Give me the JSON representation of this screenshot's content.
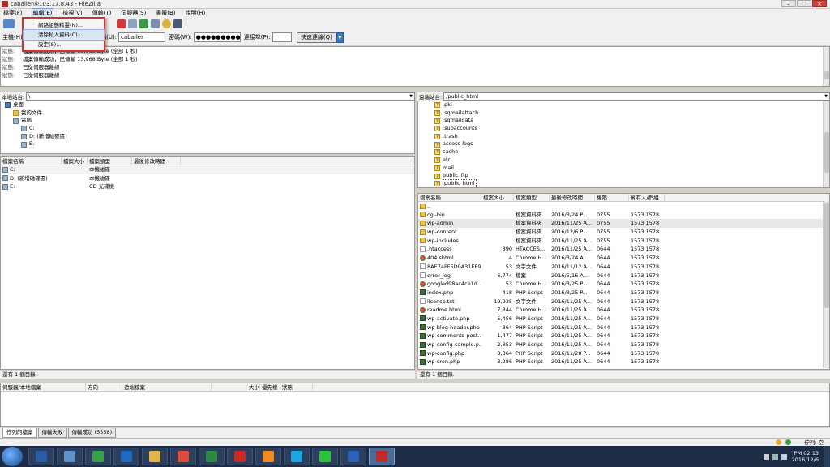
{
  "window": {
    "title": "caballer@103.17.8.43 - FileZilla"
  },
  "menubar": [
    "檔案(F)",
    "編輯(E)",
    "檢視(V)",
    "傳輸(T)",
    "伺服器(S)",
    "書籤(B)",
    "說明(H)"
  ],
  "edit_menu": {
    "items": [
      "網路組態精靈(N)...",
      "清除私人資料(C)...",
      "設定(S)..."
    ],
    "highlighted": 1
  },
  "quickconnect": {
    "host_label": "主機(H):",
    "user_label": "使用者名稱(U):",
    "user_value": "caballer",
    "pass_label": "密碼(W):",
    "pass_value": "●●●●●●●●●",
    "port_label": "連接埠(P):",
    "port_value": "",
    "button": "快速連線(Q)"
  },
  "log": [
    {
      "k": "狀態:",
      "v": "檔案傳輸成功，已傳輸 13,968 Byte (全部 1 秒)"
    },
    {
      "k": "狀態:",
      "v": "檔案傳輸成功，已傳輸 13,968 Byte (全部 1 秒)"
    },
    {
      "k": "狀態:",
      "v": "已從伺服器離線"
    },
    {
      "k": "狀態:",
      "v": "已從伺服器離線"
    }
  ],
  "local": {
    "path_label": "本地站台:",
    "path": "\\",
    "tree": [
      {
        "label": "桌面",
        "icon": "desk",
        "indent": 0
      },
      {
        "label": "我的文件",
        "icon": "folder",
        "indent": 1
      },
      {
        "label": "電腦",
        "icon": "drive",
        "indent": 1
      },
      {
        "label": "C:",
        "icon": "drive",
        "indent": 2
      },
      {
        "label": "D: (新增磁碟區)",
        "icon": "drive",
        "indent": 2
      },
      {
        "label": "E:",
        "icon": "drive",
        "indent": 2
      }
    ],
    "headers": [
      "檔案名稱",
      "檔案大小",
      "檔案類型",
      "最後修改時間"
    ],
    "files": [
      [
        "C:",
        "",
        "本機磁碟",
        ""
      ],
      [
        "D: (新增磁碟區)",
        "",
        "本機磁碟",
        ""
      ],
      [
        "E:",
        "",
        "CD 光碟機",
        ""
      ]
    ],
    "status": "還有 1 個目錄."
  },
  "remote": {
    "path_label": "遠端站台:",
    "path": "/public_html",
    "tree": [
      ".pki",
      ".sqmailattach",
      ".sqmaildata",
      ".subaccounts",
      ".trash",
      "access-logs",
      "cache",
      "etc",
      "mail",
      "public_ftp",
      "public_html"
    ],
    "headers": [
      "檔案名稱",
      "檔案大小",
      "檔案類型",
      "最後修改時間",
      "權限",
      "擁有人/群組"
    ],
    "files": [
      {
        "icon": "up",
        "c": [
          "..",
          "",
          "",
          "",
          "",
          ""
        ]
      },
      {
        "icon": "folder",
        "c": [
          "cgi-bin",
          "",
          "檔案資料夾",
          "2016/3/24 P...",
          "0755",
          "1573 1578"
        ]
      },
      {
        "icon": "folder",
        "c": [
          "wp-admin",
          "",
          "檔案資料夾",
          "2016/11/25 A...",
          "0755",
          "1573 1578"
        ]
      },
      {
        "icon": "folder",
        "c": [
          "wp-content",
          "",
          "檔案資料夾",
          "2016/12/6 P...",
          "0755",
          "1573 1578"
        ]
      },
      {
        "icon": "folder",
        "c": [
          "wp-includes",
          "",
          "檔案資料夾",
          "2016/11/25 A...",
          "0755",
          "1573 1578"
        ]
      },
      {
        "icon": "file",
        "c": [
          ".htaccess",
          "890",
          "HTACCES...",
          "2016/11/25 A...",
          "0644",
          "1573 1578"
        ]
      },
      {
        "icon": "chrome",
        "c": [
          "404.shtml",
          "4",
          "Chrome H...",
          "2016/3/24 A...",
          "0644",
          "1573 1578"
        ]
      },
      {
        "icon": "file",
        "c": [
          "8AE74FF5D0A31EE9...",
          "53",
          "文字文件",
          "2016/11/12 A...",
          "0644",
          "1573 1578"
        ]
      },
      {
        "icon": "file",
        "c": [
          "error_log",
          "6,774",
          "檔案",
          "2016/5/16 A...",
          "0644",
          "1573 1578"
        ]
      },
      {
        "icon": "chrome",
        "c": [
          "googled98ac4ce1d...",
          "53",
          "Chrome H...",
          "2016/3/25 P...",
          "0644",
          "1573 1578"
        ]
      },
      {
        "icon": "php",
        "c": [
          "index.php",
          "418",
          "PHP Script",
          "2016/3/25 P...",
          "0644",
          "1573 1578"
        ]
      },
      {
        "icon": "file",
        "c": [
          "license.txt",
          "19,935",
          "文字文件",
          "2016/11/25 A...",
          "0644",
          "1573 1578"
        ]
      },
      {
        "icon": "chrome",
        "c": [
          "readme.html",
          "7,344",
          "Chrome H...",
          "2016/11/25 A...",
          "0644",
          "1573 1578"
        ]
      },
      {
        "icon": "php",
        "c": [
          "wp-activate.php",
          "5,456",
          "PHP Script",
          "2016/11/25 A...",
          "0644",
          "1573 1578"
        ]
      },
      {
        "icon": "php",
        "c": [
          "wp-blog-header.php",
          "364",
          "PHP Script",
          "2016/11/25 A...",
          "0644",
          "1573 1578"
        ]
      },
      {
        "icon": "php",
        "c": [
          "wp-comments-post....",
          "1,477",
          "PHP Script",
          "2016/11/25 A...",
          "0644",
          "1573 1578"
        ]
      },
      {
        "icon": "php",
        "c": [
          "wp-config-sample.p...",
          "2,853",
          "PHP Script",
          "2016/11/25 A...",
          "0644",
          "1573 1578"
        ]
      },
      {
        "icon": "php",
        "c": [
          "wp-config.php",
          "3,364",
          "PHP Script",
          "2016/11/28 P...",
          "0644",
          "1573 1578"
        ]
      },
      {
        "icon": "php",
        "c": [
          "wp-cron.php",
          "3,286",
          "PHP Script",
          "2016/11/25 A...",
          "0644",
          "1573 1578"
        ]
      }
    ],
    "status": "還有 1 個目錄."
  },
  "queue": {
    "headers": [
      "伺服器/本地檔案",
      "方向",
      "遠端檔案",
      "大小",
      "優先權",
      "狀態"
    ],
    "tabs": [
      "佇列的檔案",
      "傳輸失敗",
      "傳輸成功 (5558)"
    ]
  },
  "statusbar": {
    "queue": "佇列: 空"
  },
  "taskbar": {
    "apps": [
      {
        "name": "ps",
        "color": "#2b5ca8"
      },
      {
        "name": "explorer",
        "color": "#5f92c8"
      },
      {
        "name": "xbox",
        "color": "#3aa14a"
      },
      {
        "name": "outlook",
        "color": "#1f6bbf"
      },
      {
        "name": "folder",
        "color": "#e0b84a"
      },
      {
        "name": "chrome",
        "color": "#de4c3b"
      },
      {
        "name": "excel",
        "color": "#2a8a45"
      },
      {
        "name": "acrobat",
        "color": "#c92a2a"
      },
      {
        "name": "illustrator",
        "color": "#f08a24"
      },
      {
        "name": "skype",
        "color": "#1ca6e2"
      },
      {
        "name": "line",
        "color": "#2ec23c"
      },
      {
        "name": "word",
        "color": "#2b62b8"
      },
      {
        "name": "filezilla",
        "color": "#bf2a2a"
      }
    ],
    "time": "PM 02:13",
    "date": "2016/12/6"
  }
}
